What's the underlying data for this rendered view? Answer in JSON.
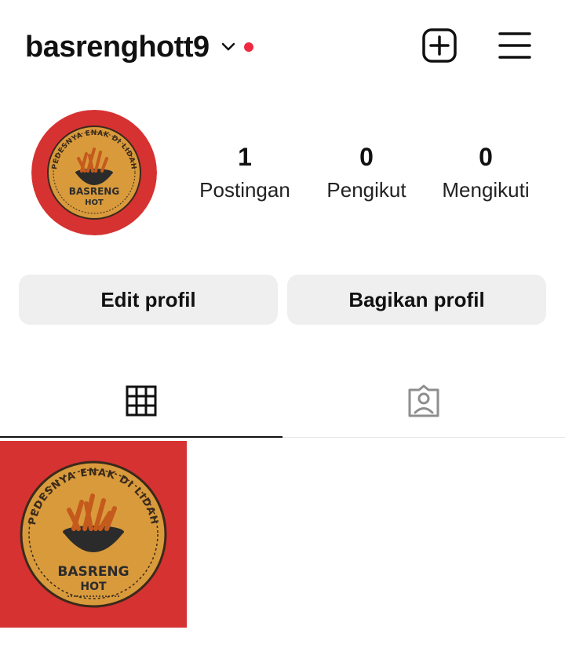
{
  "header": {
    "username": "basrenghott9",
    "chevron_icon": "chevron-down-icon",
    "notification_dot_color": "#ee2a43",
    "create_icon": "plus-square-icon",
    "menu_icon": "hamburger-menu-icon"
  },
  "profile": {
    "avatar_icon": "basreng-hot-logo",
    "stats": [
      {
        "count": "1",
        "label": "Postingan"
      },
      {
        "count": "0",
        "label": "Pengikut"
      },
      {
        "count": "0",
        "label": "Mengikuti"
      }
    ]
  },
  "actions": {
    "edit_label": "Edit profil",
    "share_label": "Bagikan profil"
  },
  "tabs": {
    "grid_icon": "grid-icon",
    "tagged_icon": "tagged-person-icon"
  },
  "posts": [
    {
      "icon": "basreng-hot-logo"
    }
  ],
  "logo": {
    "top_text": "PEDESNYA ENAK DI LIDAH",
    "brand_line1": "BASRENG",
    "brand_line2": "HOT"
  },
  "colors": {
    "brand_red": "#d63232",
    "badge_gold": "#d99a3c",
    "button_gray": "#efefef"
  }
}
